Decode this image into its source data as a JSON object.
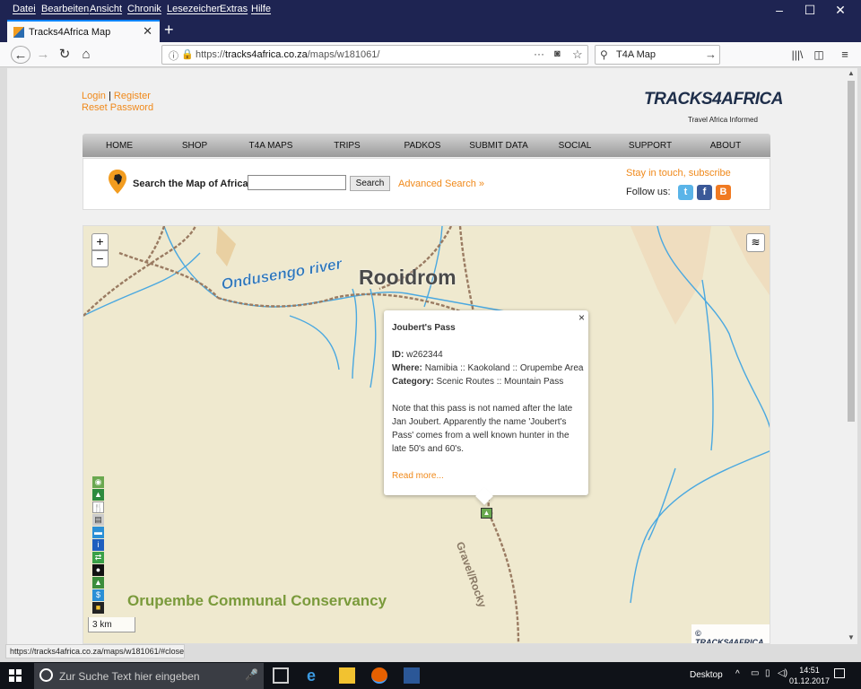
{
  "menubar": [
    "Datei",
    "Bearbeiten",
    "Ansicht",
    "Chronik",
    "Lesezeichen",
    "Extras",
    "Hilfe"
  ],
  "tab": {
    "title": "Tracks4Africa Map"
  },
  "url": {
    "prefix": "https://",
    "domain": "tracks4africa.co.za",
    "path": "/maps/w181061/"
  },
  "search": {
    "value": "T4A Map"
  },
  "header": {
    "login": "Login",
    "sep": " | ",
    "register": "Register",
    "reset": "Reset Password",
    "logo": "TRACKS4AFRICA",
    "tagline": "Travel Africa Informed"
  },
  "nav": [
    "HOME",
    "SHOP",
    "T4A MAPS",
    "TRIPS",
    "PADKOS",
    "SUBMIT DATA",
    "SOCIAL",
    "SUPPORT",
    "ABOUT"
  ],
  "mapsearch": {
    "label": "Search the Map of Africa:",
    "button": "Search",
    "advanced": "Advanced Search »",
    "stay": "Stay in touch, subscribe",
    "follow": "Follow us:"
  },
  "map": {
    "river": "Ondusengo river",
    "town": "Rooidrom",
    "conservancy": "Orupembe Communal Conservancy",
    "road": "Gravel/Rocky",
    "scale": "3 km",
    "attribution": "© TRACKS4AFRICA",
    "zoom_in": "+",
    "zoom_out": "−"
  },
  "popup": {
    "title": "Joubert's Pass",
    "id_label": "ID:",
    "id": "w262344",
    "where_label": "Where:",
    "where": "Namibia :: Kaokoland :: Orupembe Area",
    "cat_label": "Category:",
    "cat": "Scenic Routes :: Mountain Pass",
    "note": "Note that this pass is not named after the late Jan Joubert. Apparently the name 'Joubert's Pass' comes from a well known hunter in the late 50's and 60's.",
    "read_more": "Read more...",
    "close": "×"
  },
  "status": "https://tracks4africa.co.za/maps/w181061/#close",
  "taskbar": {
    "search": "Zur Suche Text hier eingeben",
    "desktop": "Desktop",
    "time": "14:51",
    "date": "01.12.2017"
  }
}
